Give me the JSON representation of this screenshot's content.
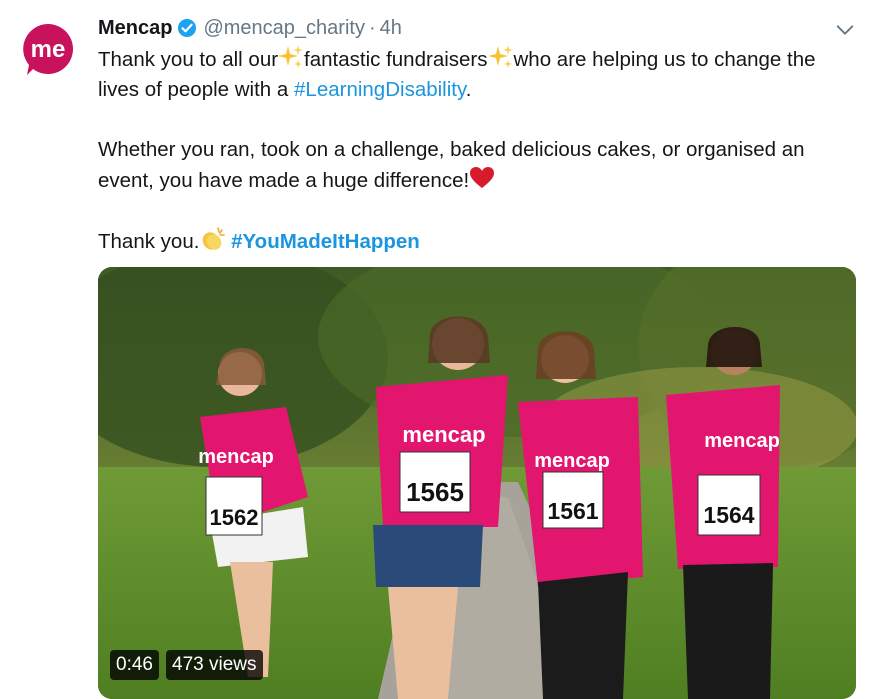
{
  "account": {
    "name": "Mencap",
    "handle": "@mencap_charity",
    "separator": "·",
    "time": "4h",
    "avatar_text": "me",
    "verified": true
  },
  "tweet": {
    "line1_a": "Thank you to all our",
    "line1_b": "fantastic fundraisers",
    "line1_c": "who are helping us to change the lives of people with a",
    "hashtag1": "#LearningDisability",
    "line1_end": ".",
    "para2": "Whether you ran, took on a challenge, baked delicious cakes, or organised an event, you have made a huge difference!",
    "para3_a": "Thank you.",
    "hashtag2": "#YouMadeItHappen"
  },
  "media": {
    "duration": "0:46",
    "views": "473 views",
    "shirt_text": "mencap",
    "bib_numbers": [
      "1562",
      "1565",
      "1561",
      "1564"
    ]
  },
  "icons": {
    "verified": "verified-badge-icon",
    "caret": "chevron-down-icon",
    "sparkles": "sparkles-emoji-icon",
    "heart": "red-heart-emoji-icon",
    "clap": "clapping-hands-emoji-icon"
  },
  "colors": {
    "brand": "#c8135c",
    "link": "#1b95e0",
    "secondary_text": "#657786",
    "verified": "#1da1f2"
  }
}
